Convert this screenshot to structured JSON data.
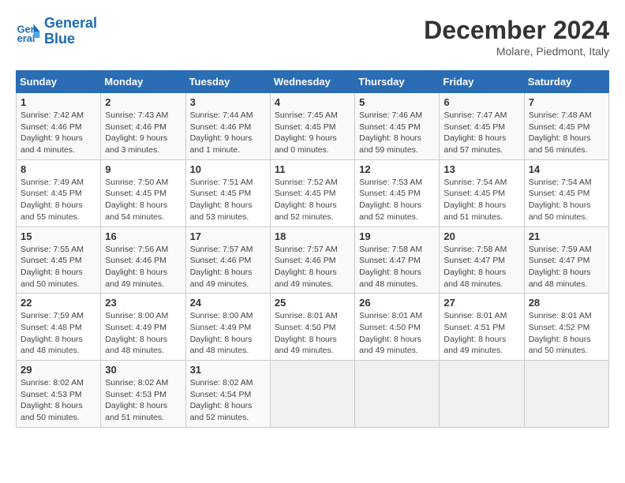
{
  "header": {
    "logo_line1": "General",
    "logo_line2": "Blue",
    "month": "December 2024",
    "location": "Molare, Piedmont, Italy"
  },
  "weekdays": [
    "Sunday",
    "Monday",
    "Tuesday",
    "Wednesday",
    "Thursday",
    "Friday",
    "Saturday"
  ],
  "weeks": [
    [
      {
        "day": "1",
        "rise": "7:42 AM",
        "set": "4:46 PM",
        "daylight": "9 hours and 4 minutes."
      },
      {
        "day": "2",
        "rise": "7:43 AM",
        "set": "4:46 PM",
        "daylight": "9 hours and 3 minutes."
      },
      {
        "day": "3",
        "rise": "7:44 AM",
        "set": "4:46 PM",
        "daylight": "9 hours and 1 minute."
      },
      {
        "day": "4",
        "rise": "7:45 AM",
        "set": "4:45 PM",
        "daylight": "9 hours and 0 minutes."
      },
      {
        "day": "5",
        "rise": "7:46 AM",
        "set": "4:45 PM",
        "daylight": "8 hours and 59 minutes."
      },
      {
        "day": "6",
        "rise": "7:47 AM",
        "set": "4:45 PM",
        "daylight": "8 hours and 57 minutes."
      },
      {
        "day": "7",
        "rise": "7:48 AM",
        "set": "4:45 PM",
        "daylight": "8 hours and 56 minutes."
      }
    ],
    [
      {
        "day": "8",
        "rise": "7:49 AM",
        "set": "4:45 PM",
        "daylight": "8 hours and 55 minutes."
      },
      {
        "day": "9",
        "rise": "7:50 AM",
        "set": "4:45 PM",
        "daylight": "8 hours and 54 minutes."
      },
      {
        "day": "10",
        "rise": "7:51 AM",
        "set": "4:45 PM",
        "daylight": "8 hours and 53 minutes."
      },
      {
        "day": "11",
        "rise": "7:52 AM",
        "set": "4:45 PM",
        "daylight": "8 hours and 52 minutes."
      },
      {
        "day": "12",
        "rise": "7:53 AM",
        "set": "4:45 PM",
        "daylight": "8 hours and 52 minutes."
      },
      {
        "day": "13",
        "rise": "7:54 AM",
        "set": "4:45 PM",
        "daylight": "8 hours and 51 minutes."
      },
      {
        "day": "14",
        "rise": "7:54 AM",
        "set": "4:45 PM",
        "daylight": "8 hours and 50 minutes."
      }
    ],
    [
      {
        "day": "15",
        "rise": "7:55 AM",
        "set": "4:45 PM",
        "daylight": "8 hours and 50 minutes."
      },
      {
        "day": "16",
        "rise": "7:56 AM",
        "set": "4:46 PM",
        "daylight": "8 hours and 49 minutes."
      },
      {
        "day": "17",
        "rise": "7:57 AM",
        "set": "4:46 PM",
        "daylight": "8 hours and 49 minutes."
      },
      {
        "day": "18",
        "rise": "7:57 AM",
        "set": "4:46 PM",
        "daylight": "8 hours and 49 minutes."
      },
      {
        "day": "19",
        "rise": "7:58 AM",
        "set": "4:47 PM",
        "daylight": "8 hours and 48 minutes."
      },
      {
        "day": "20",
        "rise": "7:58 AM",
        "set": "4:47 PM",
        "daylight": "8 hours and 48 minutes."
      },
      {
        "day": "21",
        "rise": "7:59 AM",
        "set": "4:47 PM",
        "daylight": "8 hours and 48 minutes."
      }
    ],
    [
      {
        "day": "22",
        "rise": "7:59 AM",
        "set": "4:48 PM",
        "daylight": "8 hours and 48 minutes."
      },
      {
        "day": "23",
        "rise": "8:00 AM",
        "set": "4:49 PM",
        "daylight": "8 hours and 48 minutes."
      },
      {
        "day": "24",
        "rise": "8:00 AM",
        "set": "4:49 PM",
        "daylight": "8 hours and 48 minutes."
      },
      {
        "day": "25",
        "rise": "8:01 AM",
        "set": "4:50 PM",
        "daylight": "8 hours and 49 minutes."
      },
      {
        "day": "26",
        "rise": "8:01 AM",
        "set": "4:50 PM",
        "daylight": "8 hours and 49 minutes."
      },
      {
        "day": "27",
        "rise": "8:01 AM",
        "set": "4:51 PM",
        "daylight": "8 hours and 49 minutes."
      },
      {
        "day": "28",
        "rise": "8:01 AM",
        "set": "4:52 PM",
        "daylight": "8 hours and 50 minutes."
      }
    ],
    [
      {
        "day": "29",
        "rise": "8:02 AM",
        "set": "4:53 PM",
        "daylight": "8 hours and 50 minutes."
      },
      {
        "day": "30",
        "rise": "8:02 AM",
        "set": "4:53 PM",
        "daylight": "8 hours and 51 minutes."
      },
      {
        "day": "31",
        "rise": "8:02 AM",
        "set": "4:54 PM",
        "daylight": "8 hours and 52 minutes."
      },
      null,
      null,
      null,
      null
    ]
  ]
}
